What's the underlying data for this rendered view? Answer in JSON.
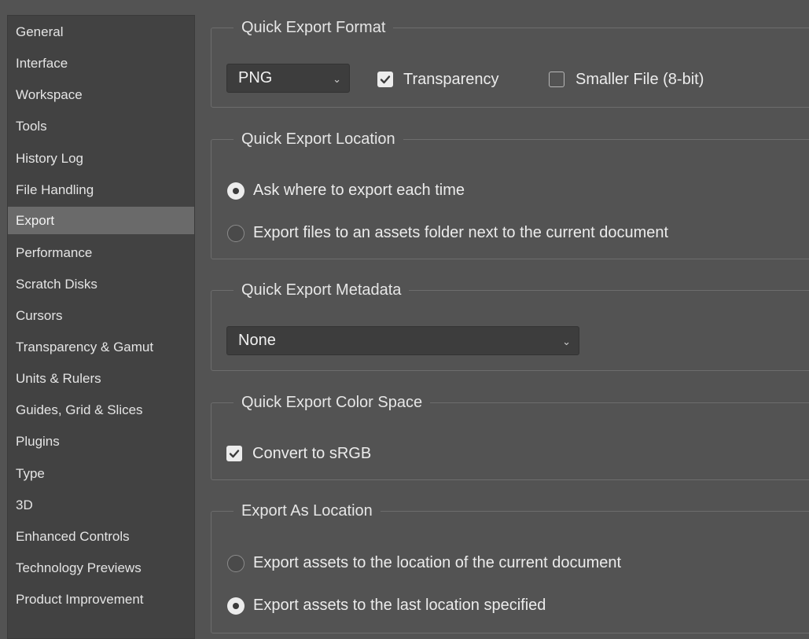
{
  "sidebar": {
    "items": [
      {
        "label": "General"
      },
      {
        "label": "Interface"
      },
      {
        "label": "Workspace"
      },
      {
        "label": "Tools"
      },
      {
        "label": "History Log"
      },
      {
        "label": "File Handling"
      },
      {
        "label": "Export"
      },
      {
        "label": "Performance"
      },
      {
        "label": "Scratch Disks"
      },
      {
        "label": "Cursors"
      },
      {
        "label": "Transparency & Gamut"
      },
      {
        "label": "Units & Rulers"
      },
      {
        "label": "Guides, Grid & Slices"
      },
      {
        "label": "Plugins"
      },
      {
        "label": "Type"
      },
      {
        "label": "3D"
      },
      {
        "label": "Enhanced Controls"
      },
      {
        "label": "Technology Previews"
      },
      {
        "label": "Product Improvement"
      }
    ],
    "selected": "Export"
  },
  "quick_export_format": {
    "title": "Quick Export Format",
    "format_value": "PNG",
    "transparency_label": "Transparency",
    "transparency_checked": true,
    "smaller_file_label": "Smaller File (8-bit)",
    "smaller_file_checked": false
  },
  "quick_export_location": {
    "title": "Quick Export Location",
    "option_ask_label": "Ask where to export each time",
    "option_assets_label": "Export files to an assets folder next to the current document",
    "selected": "ask"
  },
  "quick_export_metadata": {
    "title": "Quick Export Metadata",
    "metadata_value": "None"
  },
  "quick_export_color_space": {
    "title": "Quick Export Color Space",
    "convert_srgb_label": "Convert to sRGB",
    "convert_srgb_checked": true
  },
  "export_as_location": {
    "title": "Export As Location",
    "option_current_doc_label": "Export assets to the location of the current document",
    "option_last_location_label": "Export assets to the last location specified",
    "selected": "last_location"
  },
  "icons": {
    "chevron": "chevron-down-icon",
    "checkmark": "checkmark-icon"
  },
  "colors": {
    "panel_bg": "#535353",
    "sidebar_bg": "#424242",
    "selected_item_bg": "#6a6a6a",
    "text": "#ececec"
  }
}
